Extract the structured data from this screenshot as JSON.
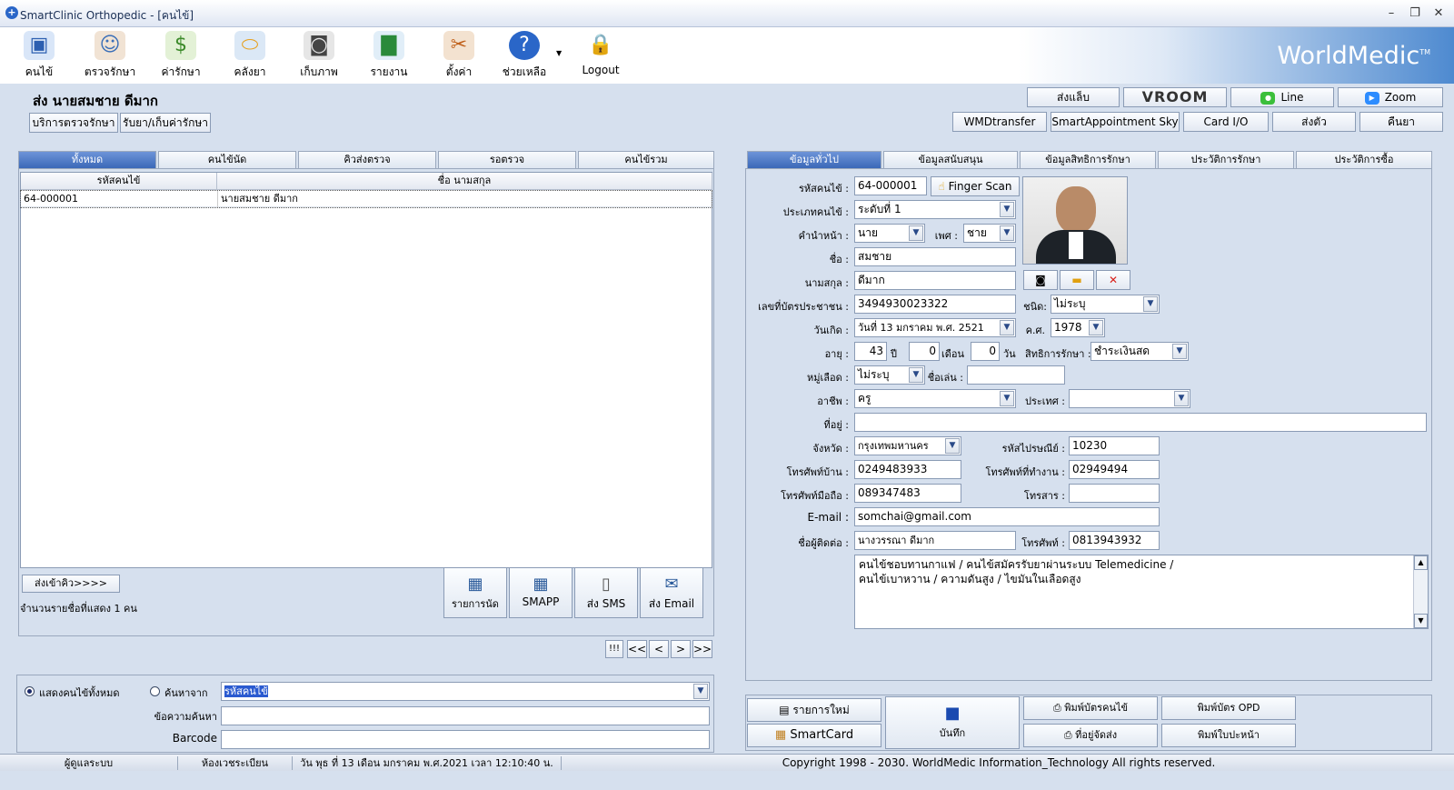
{
  "window": {
    "title": "SmartClinic Orthopedic - [คนไข้]"
  },
  "toolbar": {
    "items": [
      {
        "label": "คนไข้",
        "icon": "patient-icon"
      },
      {
        "label": "ตรวจรักษา",
        "icon": "doctor-icon"
      },
      {
        "label": "ค่ารักษา",
        "icon": "money-icon"
      },
      {
        "label": "คลังยา",
        "icon": "pill-icon"
      },
      {
        "label": "เก็บภาพ",
        "icon": "camera-icon"
      },
      {
        "label": "รายงาน",
        "icon": "chart-icon"
      },
      {
        "label": "ตั้งค่า",
        "icon": "tools-icon"
      },
      {
        "label": "ช่วยเหลือ",
        "icon": "help-icon"
      },
      {
        "label": "Logout",
        "icon": "lock-icon"
      }
    ],
    "brand": "WorldMedic",
    "brand_tm": "TM"
  },
  "patient": {
    "title": "ส่ง  นายสมชาย ดีมาก"
  },
  "topbuttons": {
    "left": [
      "บริการตรวจรักษา",
      "รับยา/เก็บค่ารักษา"
    ],
    "row1": [
      "ส่งแล็บ",
      "VROOM",
      "Line",
      "Zoom"
    ],
    "row2": [
      "WMDtransfer",
      "SmartAppointment Sky",
      "Card I/O",
      "ส่งตัว",
      "คืนยา"
    ]
  },
  "left": {
    "tabs": [
      "ทั้งหมด",
      "คนไข้นัด",
      "คิวส่งตรวจ",
      "รอตรวจ",
      "คนไข้รวม"
    ],
    "columns": [
      "รหัสคนไข้",
      "ชื่อ นามสกุล"
    ],
    "rows": [
      {
        "id": "64-000001",
        "name": "นายสมชาย ดีมาก"
      }
    ],
    "queue_button": "ส่งเข้าคิว>>>>",
    "count_text": "จำนวนรายชื่อที่แสดง 1 คน",
    "actions": [
      "รายการนัด",
      "SMAPP",
      "ส่ง SMS",
      "ส่ง Email"
    ],
    "pager": [
      "!!!",
      "<<",
      "<",
      ">",
      ">>"
    ]
  },
  "search": {
    "radio_all": "แสดงคนไข้ทั้งหมด",
    "radio_search": "ค้นหาจาก",
    "search_by": "รหัสคนไข้",
    "label_text": "ข้อความค้นหา",
    "label_barcode": "Barcode"
  },
  "right": {
    "tabs": [
      "ข้อมูลทั่วไป",
      "ข้อมูลสนับสนุน",
      "ข้อมูลสิทธิการรักษา",
      "ประวัติการรักษา",
      "ประวัติการซื้อ"
    ],
    "labels": {
      "hn": "รหัสคนไข้ :",
      "type": "ประเภทคนไข้ :",
      "prefix": "คำนำหน้า :",
      "sex": "เพศ :",
      "fname": "ชื่อ :",
      "lname": "นามสกุล :",
      "idcard": "เลขที่บัตรประชาชน :",
      "idtype": "ชนิด:",
      "dob": "วันเกิด :",
      "ce": "ค.ศ.",
      "age": "อายุ :",
      "year": "ปี",
      "month": "เดือน",
      "day": "วัน",
      "right": "สิทธิการรักษา :",
      "blood": "หมู่เลือด :",
      "nick": "ชื่อเล่น :",
      "job": "อาชีพ :",
      "country": "ประเทศ :",
      "address": "ที่อยู่ :",
      "province": "จังหวัด :",
      "zip": "รหัสไปรษณีย์ :",
      "homephone": "โทรศัพท์บ้าน :",
      "workphone": "โทรศัพท์ที่ทำงาน :",
      "mobile": "โทรศัพท์มือถือ :",
      "fax": "โทรสาร :",
      "email": "E-mail :",
      "contact": "ชื่อผู้ติดต่อ :",
      "contactphone": "โทรศัพท์ :"
    },
    "values": {
      "hn": "64-000001",
      "finger": "Finger Scan",
      "type": "ระดับที่ 1",
      "prefix": "นาย",
      "sex": "ชาย",
      "fname": "สมชาย",
      "lname": "ดีมาก",
      "idcard": "3494930023322",
      "idtype": "ไม่ระบุ",
      "dob": "วันที่ 13  มกราคม  พ.ศ.  2521",
      "ce": "1978",
      "age_y": "43",
      "age_m": "0",
      "age_d": "0",
      "right": "ชำระเงินสด",
      "blood": "ไม่ระบุ",
      "nick": "",
      "job": "ครู",
      "country": "",
      "address": "",
      "province": "กรุงเทพมหานคร",
      "zip": "10230",
      "homephone": "0249483933",
      "workphone": "02949494",
      "mobile": "089347483",
      "fax": "",
      "email": "somchai@gmail.com",
      "contact": "นางวรรณา ดีมาก",
      "contactphone": "0813943932"
    },
    "note": [
      "คนไข้ชอบทานกาแฟ / คนไข้สมัครรับยาผ่านระบบ Telemedicine /",
      "คนไข้เบาหวาน / ความดันสูง / ไขมันในเลือดสูง"
    ],
    "bottom": {
      "new": "รายการใหม่",
      "smartcard": "SmartCard",
      "save": "บันทึก",
      "print_card": "พิมพ์บัตรคนไข้",
      "address_label": "ที่อยู่จัดส่ง",
      "opd": "พิมพ์บัตร OPD",
      "cover": "พิมพ์ใบปะหน้า"
    }
  },
  "status": {
    "user": "ผู้ดูแลระบบ",
    "room": "ห้องเวชระเบียน",
    "datetime": "วัน พุธ ที่ 13 เดือน มกราคม พ.ศ.2021 เวลา 12:10:40 น.",
    "copyright": "Copyright 1998 - 2030. WorldMedic Information_Technology All rights reserved."
  },
  "colors": {
    "accent": "#3b68b8",
    "panel": "#d6e0ee"
  }
}
